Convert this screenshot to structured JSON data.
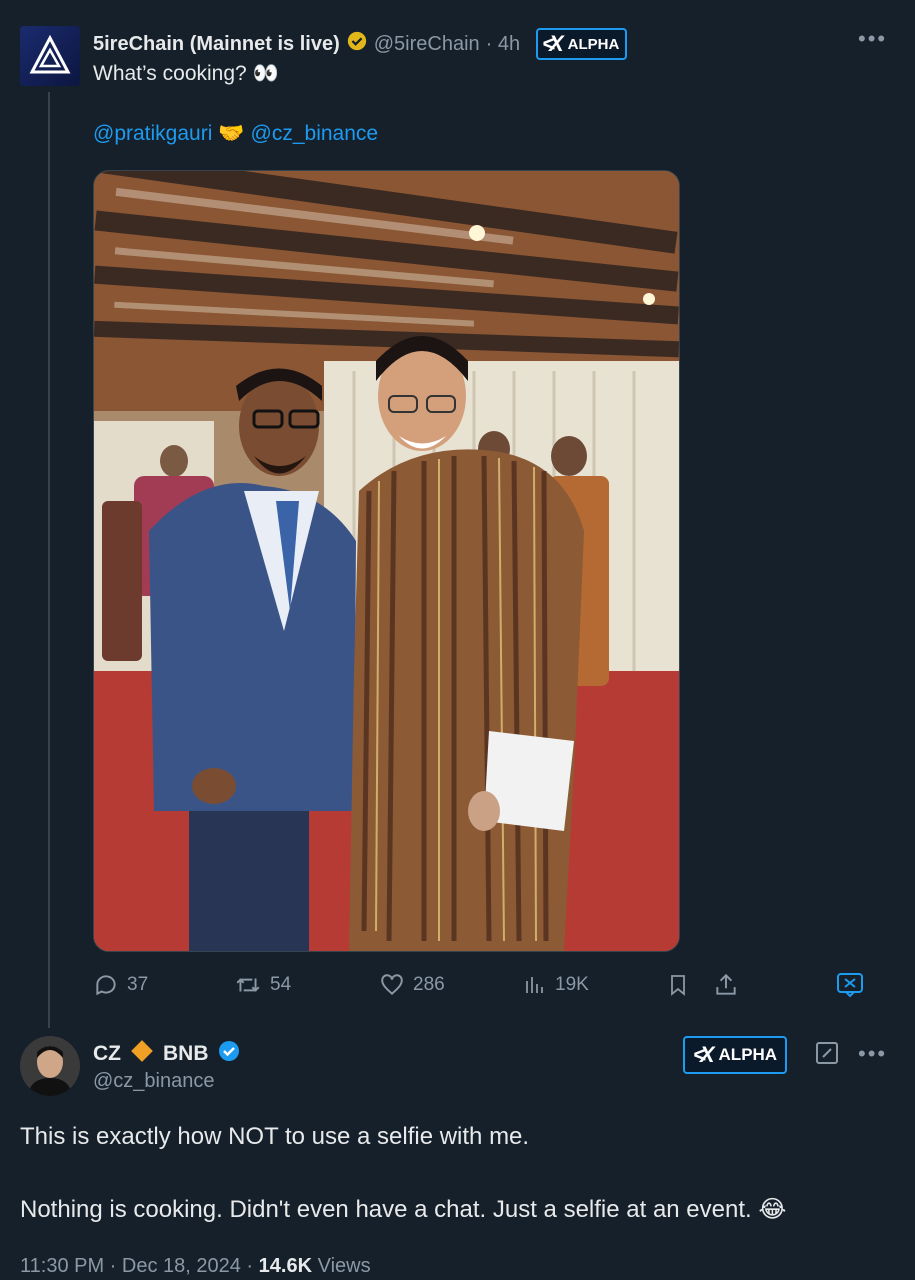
{
  "tweet1": {
    "name": "5ireChain (Mainnet is live)",
    "handle": "@5ireChain",
    "time": "· 4h",
    "badge": "ALPHA",
    "text": "What’s cooking? 👀",
    "mention1": "@pratikgauri",
    "mention_emoji": "🤝",
    "mention2": "@cz_binance",
    "stats": {
      "replies": "37",
      "reposts": "54",
      "likes": "286",
      "views": "19K"
    }
  },
  "tweet2": {
    "name": "CZ",
    "bnb": "BNB",
    "handle": "@cz_binance",
    "badge": "ALPHA",
    "line1": "This is exactly how NOT to use a selfie with me.",
    "line2": "Nothing is cooking. Didn't even have a chat. Just a selfie at an event. 😂",
    "time": "11:30 PM · Dec 18, 2024 · ",
    "views_count": "14.6K",
    "views_label": "Views"
  },
  "colors": {
    "background": "#15202b",
    "accent": "#1d9bf0",
    "muted": "#8b98a5",
    "text": "#e7e9ea",
    "verified_gold": "#e2b719",
    "bnb_orange": "#f0a024"
  }
}
